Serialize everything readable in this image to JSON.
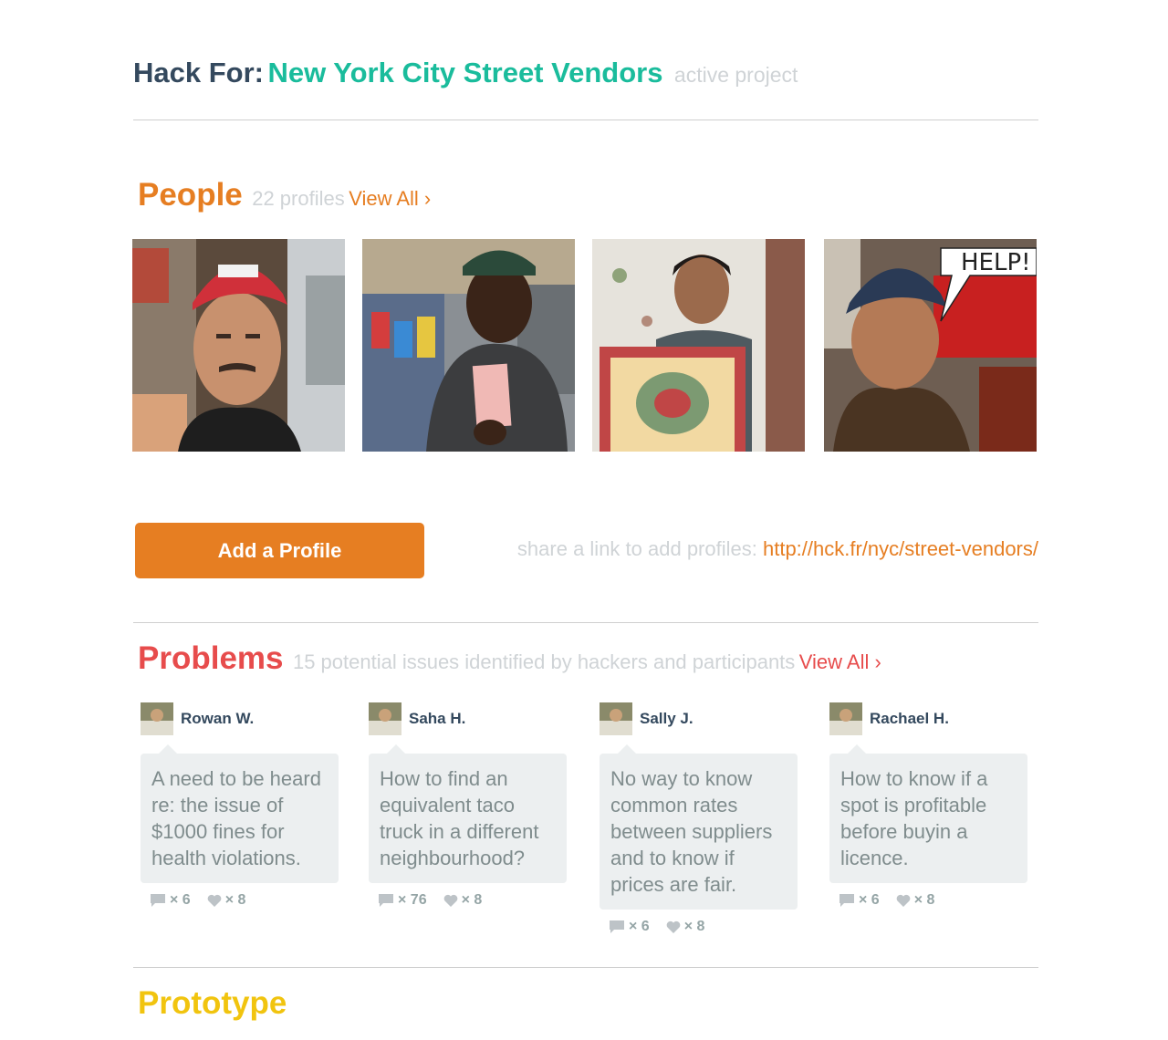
{
  "header": {
    "prefix": "Hack For:",
    "project_name": "New York City Street Vendors",
    "status": "active project"
  },
  "people": {
    "title": "People",
    "count_text": "22 profiles",
    "view_all": "View All ›",
    "photos": [
      {
        "icon": "vendor-photo-red-cap"
      },
      {
        "icon": "vendor-photo-ticket"
      },
      {
        "icon": "vendor-photo-rug"
      },
      {
        "icon": "vendor-photo-help",
        "speech": "HELP!"
      }
    ]
  },
  "add_profile": {
    "button": "Add a Profile",
    "share_text": "share a link to add profiles:",
    "share_url": "http://hck.fr/nyc/street-vendors/"
  },
  "problems": {
    "title": "Problems",
    "count_text": "15 potential issues identified by hackers and participants",
    "view_all": "View All ›",
    "items": [
      {
        "author": "Rowan W.",
        "text": "A need to be heard re: the issue of $1000 fines for health violations.",
        "comments": "× 6",
        "likes": "× 8"
      },
      {
        "author": "Saha H.",
        "text": "How to find an equivalent taco truck in a different neighbourhood?",
        "comments": "× 76",
        "likes": "× 8"
      },
      {
        "author": "Sally J.",
        "text": "No way to know common rates between suppliers and to know if prices are fair.",
        "comments": "× 6",
        "likes": "× 8"
      },
      {
        "author": "Rachael H.",
        "text": "How to know if a spot is profitable before buyin a licence.",
        "comments": "× 6",
        "likes": "× 8"
      }
    ]
  },
  "prototype": {
    "title": "Prototype"
  },
  "colors": {
    "teal": "#1abc9c",
    "orange": "#e67e22",
    "red": "#e74c4c",
    "yellow": "#f1c40f",
    "navy": "#34495e"
  }
}
